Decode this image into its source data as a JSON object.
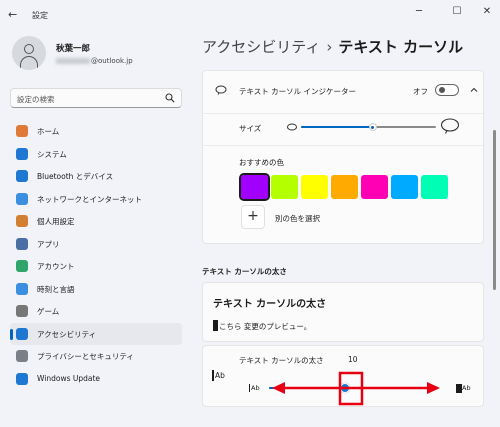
{
  "titlebar": {
    "back": "←",
    "title": "設定",
    "minimize": "─",
    "maximize": "☐",
    "close": "✕"
  },
  "user": {
    "name": "秋葉一郎",
    "email_domain": "@outlook.jp"
  },
  "search": {
    "placeholder": "設定の検索"
  },
  "nav": [
    {
      "label": "ホーム",
      "icon": "home-icon",
      "color": "#e07a3a"
    },
    {
      "label": "システム",
      "icon": "system-icon",
      "color": "#1e78d2"
    },
    {
      "label": "Bluetooth とデバイス",
      "icon": "bluetooth-icon",
      "color": "#1e78d2"
    },
    {
      "label": "ネットワークとインターネット",
      "icon": "network-icon",
      "color": "#3a8fe0"
    },
    {
      "label": "個人用設定",
      "icon": "personalization-icon",
      "color": "#d08030"
    },
    {
      "label": "アプリ",
      "icon": "apps-icon",
      "color": "#4a6fa5"
    },
    {
      "label": "アカウント",
      "icon": "account-icon",
      "color": "#2fa56b"
    },
    {
      "label": "時刻と言語",
      "icon": "time-language-icon",
      "color": "#3a8fe0"
    },
    {
      "label": "ゲーム",
      "icon": "gaming-icon",
      "color": "#777777"
    },
    {
      "label": "アクセシビリティ",
      "icon": "accessibility-icon",
      "color": "#1e78d2"
    },
    {
      "label": "プライバシーとセキュリティ",
      "icon": "privacy-icon",
      "color": "#7a7f88"
    },
    {
      "label": "Windows Update",
      "icon": "windows-update-icon",
      "color": "#1e78d2"
    }
  ],
  "header": {
    "crumb": "アクセシビリティ",
    "separator": "›",
    "current": "テキスト カーソル"
  },
  "indicator": {
    "label": "テキスト カーソル インジケーター",
    "toggle_state": "オフ",
    "size_label": "サイズ",
    "size_level": 0.53,
    "recommended_label": "おすすめの色",
    "colors": [
      "#a100ff",
      "#b4ff00",
      "#ffff00",
      "#ffaa00",
      "#ff00b4",
      "#00aaff",
      "#00ffb4"
    ],
    "selected_color": "#a100ff",
    "other_color_label": "別の色を選択"
  },
  "thickness": {
    "section_heading": "テキスト カーソルの太さ",
    "card_title": "テキスト カーソルの太さ",
    "preview_text": "こちら 変更のプレビュー。",
    "slider_label": "テキスト カーソルの太さ",
    "value": "10",
    "value_fraction": 0.47,
    "sample_left": "Ab",
    "sample_right": "Ab",
    "sample_label": "Ab"
  },
  "colors": {
    "accent": "#0067c0",
    "highlight": "#e60012"
  }
}
